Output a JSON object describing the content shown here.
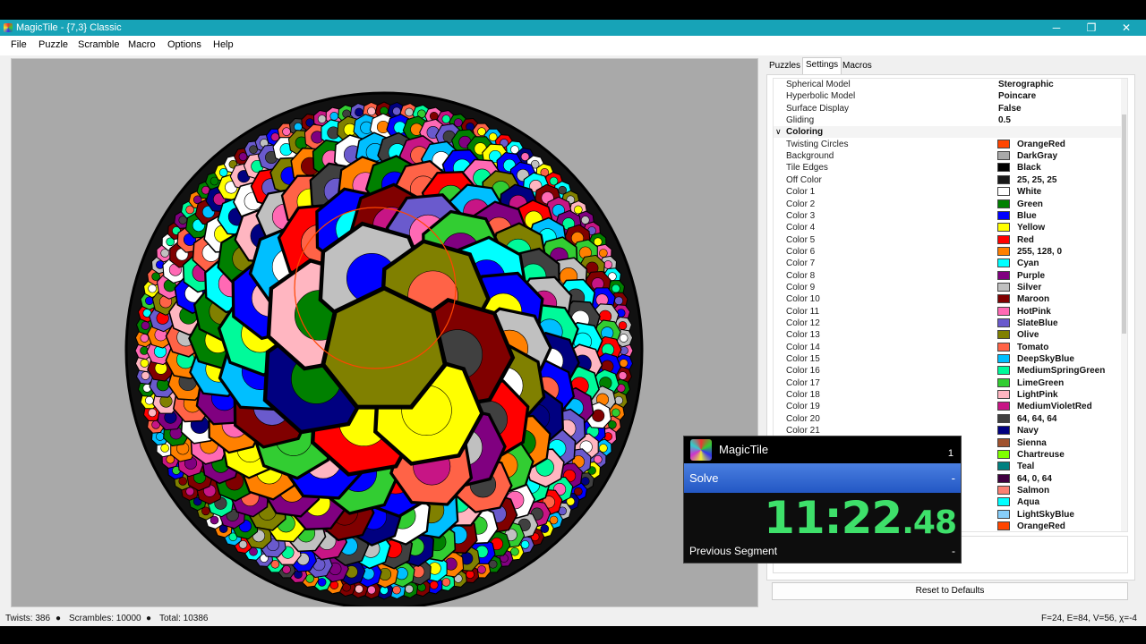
{
  "window": {
    "title": "MagicTile - {7,3} Classic",
    "minimize": "─",
    "maximize": "❐",
    "close": "✕"
  },
  "menu": [
    "File",
    "Puzzle",
    "Scramble",
    "Macro",
    "Options",
    "Help"
  ],
  "tabs": [
    "Puzzles",
    "Settings",
    "Macros"
  ],
  "active_tab": "Settings",
  "settings": [
    {
      "name": "Spherical Model",
      "value": "Sterographic"
    },
    {
      "name": "Hyperbolic Model",
      "value": "Poincare"
    },
    {
      "name": "Surface Display",
      "value": "False"
    },
    {
      "name": "Gliding",
      "value": "0.5"
    },
    {
      "category": "Coloring"
    },
    {
      "name": "Twisting Circles",
      "value": "OrangeRed",
      "color": "#ff4500"
    },
    {
      "name": "Background",
      "value": "DarkGray",
      "color": "#a9a9a9"
    },
    {
      "name": "Tile Edges",
      "value": "Black",
      "color": "#000000"
    },
    {
      "name": "Off Color",
      "value": "25, 25, 25",
      "color": "#191919"
    },
    {
      "name": "Color 1",
      "value": "White",
      "color": "#ffffff"
    },
    {
      "name": "Color 2",
      "value": "Green",
      "color": "#008000"
    },
    {
      "name": "Color 3",
      "value": "Blue",
      "color": "#0000ff"
    },
    {
      "name": "Color 4",
      "value": "Yellow",
      "color": "#ffff00"
    },
    {
      "name": "Color 5",
      "value": "Red",
      "color": "#ff0000"
    },
    {
      "name": "Color 6",
      "value": "255, 128, 0",
      "color": "#ff8000"
    },
    {
      "name": "Color 7",
      "value": "Cyan",
      "color": "#00ffff"
    },
    {
      "name": "Color 8",
      "value": "Purple",
      "color": "#800080"
    },
    {
      "name": "Color 9",
      "value": "Silver",
      "color": "#c0c0c0"
    },
    {
      "name": "Color 10",
      "value": "Maroon",
      "color": "#800000"
    },
    {
      "name": "Color 11",
      "value": "HotPink",
      "color": "#ff69b4"
    },
    {
      "name": "Color 12",
      "value": "SlateBlue",
      "color": "#6a5acd"
    },
    {
      "name": "Color 13",
      "value": "Olive",
      "color": "#808000"
    },
    {
      "name": "Color 14",
      "value": "Tomato",
      "color": "#ff6347"
    },
    {
      "name": "Color 15",
      "value": "DeepSkyBlue",
      "color": "#00bfff"
    },
    {
      "name": "Color 16",
      "value": "MediumSpringGreen",
      "color": "#00fa9a"
    },
    {
      "name": "Color 17",
      "value": "LimeGreen",
      "color": "#32cd32"
    },
    {
      "name": "Color 18",
      "value": "LightPink",
      "color": "#ffb6c1"
    },
    {
      "name": "Color 19",
      "value": "MediumVioletRed",
      "color": "#c71585"
    },
    {
      "name": "Color 20",
      "value": "64, 64, 64",
      "color": "#404040"
    },
    {
      "name": "Color 21",
      "value": "Navy",
      "color": "#000080"
    },
    {
      "name": "",
      "value": "Sienna",
      "color": "#a0522d"
    },
    {
      "name": "",
      "value": "Chartreuse",
      "color": "#7fff00"
    },
    {
      "name": "",
      "value": "Teal",
      "color": "#008080"
    },
    {
      "name": "",
      "value": "64, 0, 64",
      "color": "#400040"
    },
    {
      "name": "",
      "value": "Salmon",
      "color": "#fa8072"
    },
    {
      "name": "",
      "value": "Aqua",
      "color": "#00ffff"
    },
    {
      "name": "",
      "value": "LightSkyBlue",
      "color": "#87cefa"
    },
    {
      "name": "",
      "value": "OrangeRed",
      "color": "#ff4500"
    }
  ],
  "reset_label": "Reset to Defaults",
  "status": {
    "twists": "Twists: 386",
    "scrambles": "Scrambles: 10000",
    "total": "Total: 10386",
    "stats": "F=24, E=84, V=56, χ=-4"
  },
  "timer": {
    "app": "MagicTile",
    "count": "1",
    "segment": "Solve",
    "segment_dash": "-",
    "time_main": "11:22",
    "time_frac": ".48",
    "prev": "Previous Segment",
    "prev_dash": "-"
  }
}
